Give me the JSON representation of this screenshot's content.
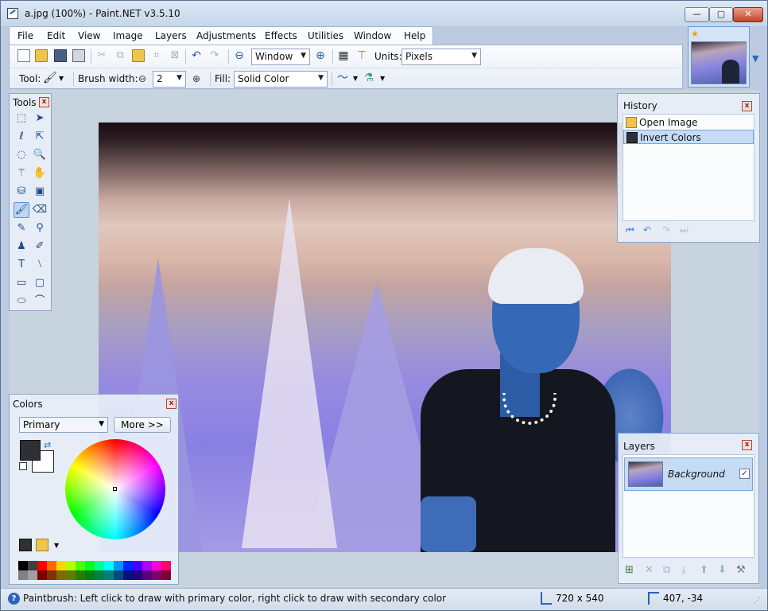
{
  "window": {
    "title": "a.jpg (100%) - Paint.NET v3.5.10",
    "minimize": "—",
    "maximize": "▢",
    "close": "✕"
  },
  "menu": {
    "items": [
      "File",
      "Edit",
      "View",
      "Image",
      "Layers",
      "Adjustments",
      "Effects",
      "Utilities",
      "Window",
      "Help"
    ]
  },
  "toolbar": {
    "zoom_value": "Window",
    "units_label": "Units:",
    "units_value": "Pixels",
    "tool_label": "Tool:",
    "brush_width_label": "Brush width:",
    "brush_width_value": "2",
    "fill_label": "Fill:",
    "fill_value": "Solid Color",
    "minus": "⊖",
    "plus": "⊕"
  },
  "tools_panel": {
    "title": "Tools",
    "close": "x",
    "tools": [
      {
        "name": "rectangle-select",
        "glyph": "⬚"
      },
      {
        "name": "move-selected",
        "glyph": "➤"
      },
      {
        "name": "lasso-select",
        "glyph": "ℓ"
      },
      {
        "name": "move-selection",
        "glyph": "⇱"
      },
      {
        "name": "ellipse-select",
        "glyph": "◌"
      },
      {
        "name": "zoom",
        "glyph": "🔍"
      },
      {
        "name": "magic-wand",
        "glyph": "⚚"
      },
      {
        "name": "pan",
        "glyph": "✋"
      },
      {
        "name": "paint-bucket",
        "glyph": "⛁"
      },
      {
        "name": "gradient",
        "glyph": "▣"
      },
      {
        "name": "paintbrush",
        "glyph": "🖌"
      },
      {
        "name": "eraser",
        "glyph": "⌫"
      },
      {
        "name": "pencil",
        "glyph": "✎"
      },
      {
        "name": "color-picker",
        "glyph": "⚲"
      },
      {
        "name": "clone-stamp",
        "glyph": "♟"
      },
      {
        "name": "recolor",
        "glyph": "✐"
      },
      {
        "name": "text",
        "glyph": "T"
      },
      {
        "name": "line-curve",
        "glyph": "⧵"
      },
      {
        "name": "rectangle",
        "glyph": "▭"
      },
      {
        "name": "rounded-rectangle",
        "glyph": "▢"
      },
      {
        "name": "ellipse",
        "glyph": "⬭"
      },
      {
        "name": "freeform-shape",
        "glyph": "⌒"
      }
    ]
  },
  "history_panel": {
    "title": "History",
    "close": "x",
    "items": [
      "Open Image",
      "Invert Colors"
    ],
    "nav": {
      "first": "⏮",
      "undo": "↶",
      "redo": "↷",
      "last": "⏭"
    }
  },
  "colors_panel": {
    "title": "Colors",
    "close": "x",
    "mode_value": "Primary",
    "more_label": "More >>",
    "swap": "⇄",
    "primary_color": "#2f3035",
    "secondary_color": "#ffffff",
    "palette": [
      "#000000",
      "#404040",
      "#ff0000",
      "#ff6a00",
      "#ffd800",
      "#b6ff00",
      "#4cff00",
      "#00ff21",
      "#00ff90",
      "#00ffff",
      "#0094ff",
      "#0026ff",
      "#4800ff",
      "#b200ff",
      "#ff00dc",
      "#ff006e",
      "#808080",
      "#a0a0a0",
      "#7f0000",
      "#7f3300",
      "#7f6a00",
      "#5b7f00",
      "#267f00",
      "#007f0e",
      "#007f46",
      "#007f7f",
      "#004a7f",
      "#00137f",
      "#21007f",
      "#57007f",
      "#7f006e",
      "#7f0037"
    ]
  },
  "layers_panel": {
    "title": "Layers",
    "close": "x",
    "layers": [
      {
        "name": "Background",
        "visible": "✓"
      }
    ],
    "tools": {
      "add": "⊞",
      "delete": "✕",
      "duplicate": "⧉",
      "merge": "⤓",
      "up": "⬆",
      "down": "⬇",
      "properties": "⚒"
    }
  },
  "status": {
    "help": "?",
    "text": "Paintbrush: Left click to draw with primary color, right click to draw with secondary color",
    "image_size": "720 x 540",
    "cursor_position": "407, -34",
    "grip": "⋰"
  },
  "nav": {
    "star": "★",
    "arrow": "▼"
  }
}
